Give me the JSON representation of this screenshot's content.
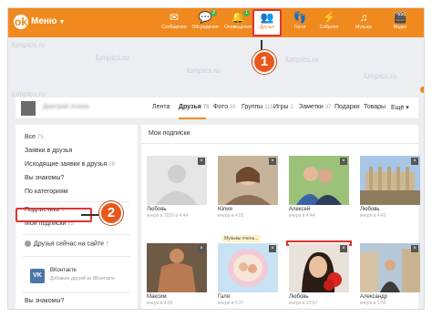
{
  "topbar": {
    "logo_glyph": "ok",
    "menu_label": "Меню",
    "nav": [
      {
        "label": "Сообщения",
        "icon": "message-icon",
        "glyph": "✉",
        "badge": ""
      },
      {
        "label": "Обсуждения",
        "icon": "discussion-icon",
        "glyph": "💬",
        "badge": "2"
      },
      {
        "label": "Оповещения",
        "icon": "bell-icon",
        "glyph": "🔔",
        "badge": "1"
      },
      {
        "label": "Друзья",
        "icon": "friends-icon",
        "glyph": "👥",
        "badge": ""
      },
      {
        "label": "Гости",
        "icon": "guests-icon",
        "glyph": "👣",
        "badge": ""
      },
      {
        "label": "События",
        "icon": "events-icon",
        "glyph": "⚡",
        "badge": ""
      },
      {
        "label": "Музыка",
        "icon": "music-icon",
        "glyph": "♫",
        "badge": ""
      },
      {
        "label": "Видео",
        "icon": "video-icon",
        "glyph": "🎬",
        "badge": ""
      }
    ]
  },
  "watermark": "lumpics.ru",
  "profile": {
    "user_name": "Дмитрий Алиев",
    "tabs": [
      {
        "label": "Лента",
        "count": ""
      },
      {
        "label": "Друзья",
        "count": "75"
      },
      {
        "label": "Фото",
        "count": "86"
      },
      {
        "label": "Группы",
        "count": "115"
      },
      {
        "label": "Игры",
        "count": "2"
      },
      {
        "label": "Заметки",
        "count": "37"
      },
      {
        "label": "Подарки",
        "count": ""
      },
      {
        "label": "Товары",
        "count": ""
      },
      {
        "label": "Ещё",
        "count": ""
      }
    ]
  },
  "sidebar": {
    "items": [
      {
        "label": "Все",
        "count": "75"
      },
      {
        "label": "Заявки в друзья",
        "count": ""
      },
      {
        "label": "Исходящие заявки в друзья",
        "count": "29"
      },
      {
        "label": "Вы знакомы?",
        "count": ""
      },
      {
        "label": "По категориям",
        "count": ""
      },
      {
        "label": "Подписчики",
        "count": "1"
      },
      {
        "label": "Мои подписки",
        "count": "85"
      },
      {
        "label": "Друзья сейчас на сайте",
        "count": "7"
      },
      {
        "label": "Вы знакомы?",
        "count": ""
      }
    ],
    "vk": {
      "logo": "VK",
      "title": "ВКонтакте",
      "subtitle": "Добавьте друзей из ВКонтакте"
    }
  },
  "main": {
    "title": "Мои подписки",
    "music_tag": "Музыкы очень...",
    "cards": [
      {
        "name": "Любовь",
        "date": "вчера в 2016 в 4:44"
      },
      {
        "name": "Юлия",
        "date": "вчера в 4:55"
      },
      {
        "name": "Алексей",
        "date": "вчера в 4:44"
      },
      {
        "name": "Любовь",
        "date": "вчера в 4:42"
      },
      {
        "name": "Максим",
        "date": "вчера в 4:55"
      },
      {
        "name": "Галя",
        "date": "вчера в 5:37"
      },
      {
        "name": "Любовь",
        "date": "вчера в 23:57"
      },
      {
        "name": "Александр",
        "date": "вчера в 1:55"
      }
    ]
  },
  "steps": [
    "1",
    "2"
  ],
  "colors": {
    "brand": "#f08a1e",
    "highlight": "#e0342f",
    "step": "#e8581c",
    "vk": "#4a76a8"
  }
}
